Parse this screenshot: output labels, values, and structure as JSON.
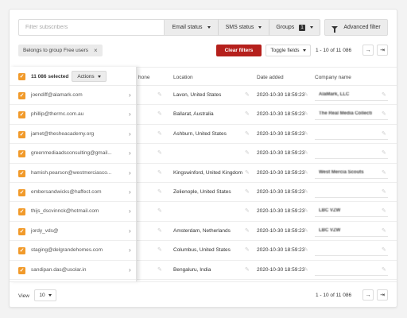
{
  "filters": {
    "search_placeholder": "Filter subscribers",
    "email_status": "Email status",
    "sms_status": "SMS status",
    "groups": "Groups",
    "groups_count": "1",
    "advanced": "Advanced filter",
    "tag": "Belongs to group Free users",
    "clear": "Clear filters",
    "toggle_fields": "Toggle fields",
    "range": "1 - 10 of 11 086"
  },
  "selection": {
    "count": "11 086 selected",
    "actions": "Actions"
  },
  "columns": {
    "phone": "hone",
    "location": "Location",
    "date_added": "Date added",
    "company": "Company name"
  },
  "rows": [
    {
      "email": "joendiff@alamark.com",
      "location": "Lavon, United States",
      "date": "2020-10-30 18:59:23",
      "company": "AlaMark, LLC"
    },
    {
      "email": "phillip@thermc.com.au",
      "location": "Ballarat, Australia",
      "date": "2020-10-30 18:59:23",
      "company": "The Real Media Collecti"
    },
    {
      "email": "jamet@thesheacademy.org",
      "location": "Ashburn, United States",
      "date": "2020-10-30 18:59:23",
      "company": ""
    },
    {
      "email": "greenmediaadsconsulting@gmail...",
      "location": "",
      "date": "2020-10-30 18:59:23",
      "company": ""
    },
    {
      "email": "hamish.pearson@westmerciasco...",
      "location": "Kingswinford, United Kingdom",
      "date": "2020-10-30 18:59:23",
      "company": "West Mercia Scouts"
    },
    {
      "email": "embersandwicks@haffect.com",
      "location": "Zelienople, United States",
      "date": "2020-10-30 18:59:23",
      "company": ""
    },
    {
      "email": "thijs_dscvinnck@hotmail.com",
      "location": "",
      "date": "2020-10-30 18:59:23",
      "company": "LBC VZW"
    },
    {
      "email": "jordy_vds@",
      "location": "Amsterdam, Netherlands",
      "date": "2020-10-30 18:59:23",
      "company": "LBC VZW"
    },
    {
      "email": "staging@delgrandehomes.com",
      "location": "Columbus, United States",
      "date": "2020-10-30 18:59:23",
      "company": ""
    },
    {
      "email": "sandipan.das@usolar.in",
      "location": "Bengaluru, India",
      "date": "2020-10-30 18:59:23",
      "company": ""
    }
  ],
  "footer": {
    "view_label": "View",
    "view_value": "10",
    "range": "1 - 10 of 11 086"
  }
}
